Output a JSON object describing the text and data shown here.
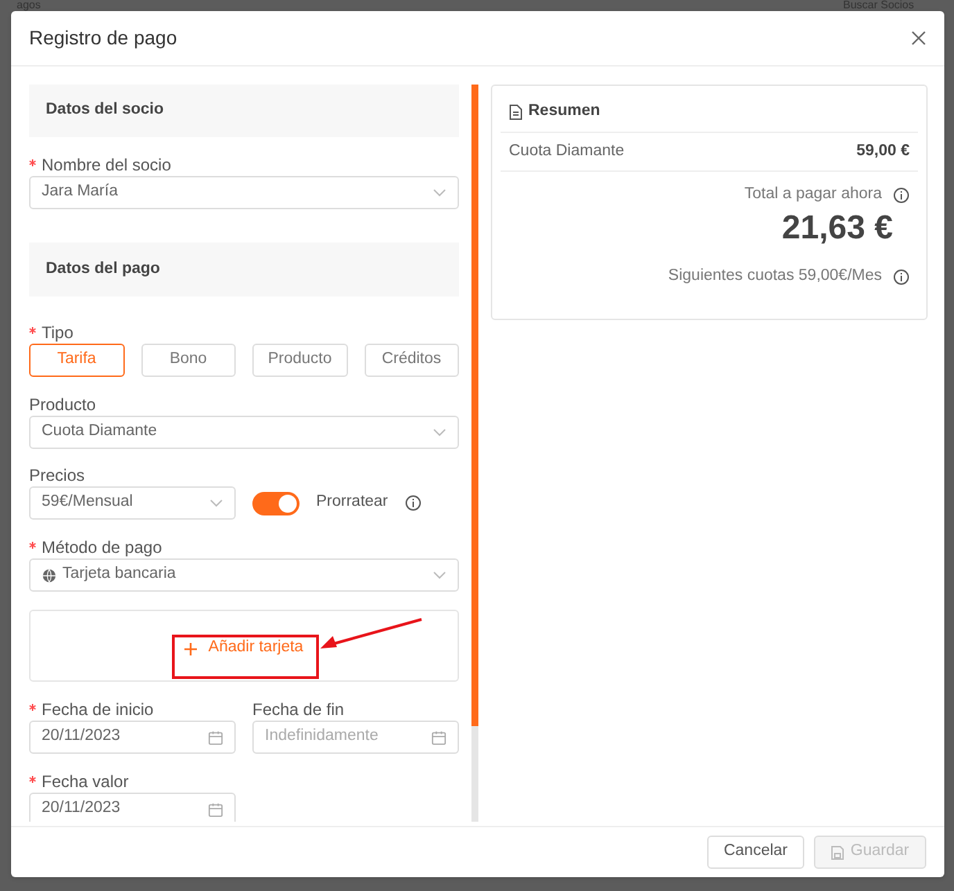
{
  "background": {
    "page_title": "agos",
    "search": {
      "placeholder": "Buscar Socios"
    }
  },
  "dialog": {
    "title": "Registro de pago"
  },
  "member_section": {
    "title": "Datos del socio",
    "member": {
      "label": "Nombre del socio",
      "required": true,
      "value": "Jara María"
    }
  },
  "payment_section": {
    "title": "Datos del pago",
    "type": {
      "label": "Tipo",
      "required": true,
      "options": [
        {
          "label": "Tarifa",
          "selected": true
        },
        {
          "label": "Bono",
          "selected": false
        },
        {
          "label": "Producto",
          "selected": false
        },
        {
          "label": "Créditos",
          "selected": false
        }
      ]
    },
    "product": {
      "label": "Producto",
      "required": false,
      "value": "Cuota Diamante"
    },
    "price": {
      "label": "Precios",
      "required": false,
      "value": "59€/Mensual"
    },
    "prorate": {
      "label": "Prorratear",
      "on": true
    },
    "method": {
      "label": "Método de pago",
      "required": true,
      "value": "Tarjeta bancaria"
    },
    "add_card": {
      "label": "Añadir tarjeta"
    },
    "start_date": {
      "label": "Fecha de inicio",
      "required": true,
      "value": "20/11/2023"
    },
    "end_date": {
      "label": "Fecha de fin",
      "required": false,
      "placeholder": "Indefinidamente"
    },
    "value_date": {
      "label": "Fecha valor",
      "required": true,
      "value": "20/11/2023"
    }
  },
  "summary": {
    "title": "Resumen",
    "line": {
      "name": "Cuota Diamante",
      "amount": "59,00 €"
    },
    "total_label": "Total a pagar ahora",
    "total": "21,63 €",
    "next": "Siguientes cuotas 59,00€/Mes"
  },
  "footer": {
    "cancel": "Cancelar",
    "save": {
      "label": "Guardar",
      "disabled": true
    }
  }
}
